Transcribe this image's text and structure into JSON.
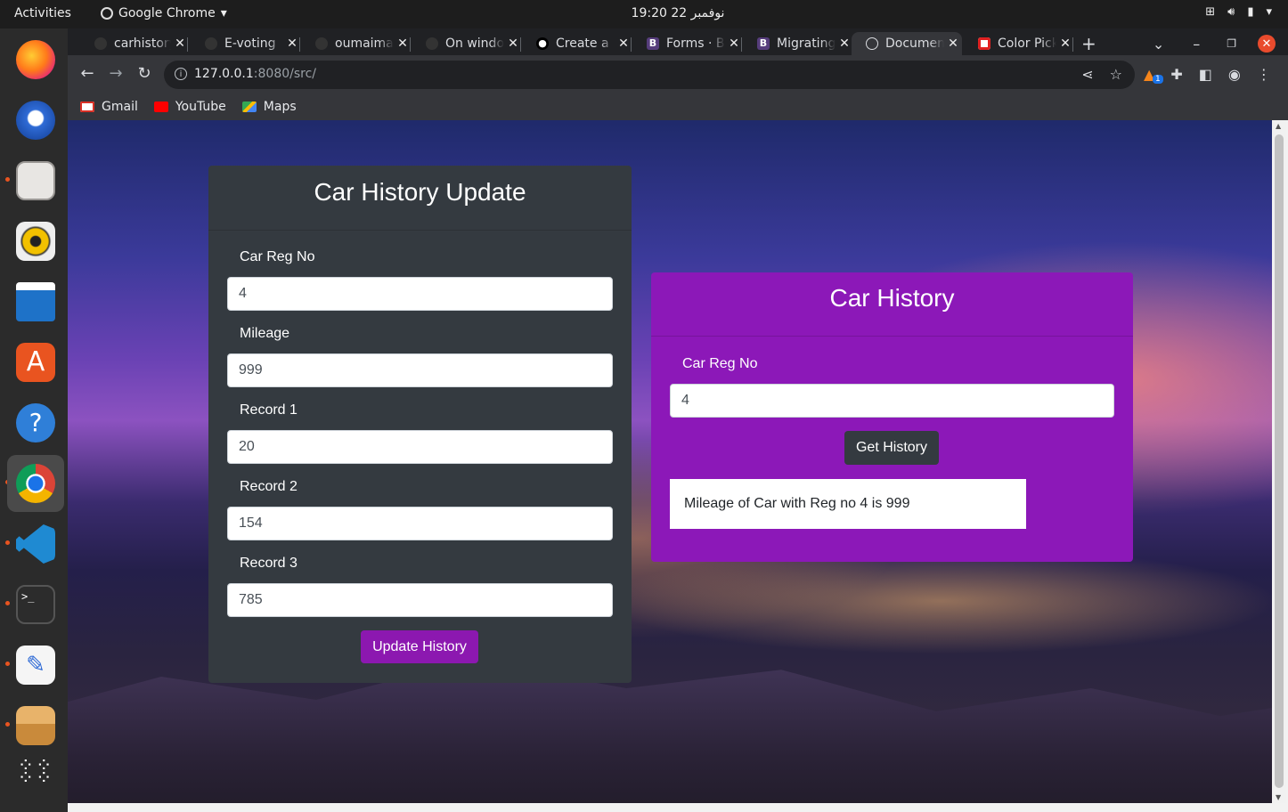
{
  "topbar": {
    "activities": "Activities",
    "app_name": "Google Chrome",
    "clock": "19:20  22 نوفمبر"
  },
  "chrome": {
    "tabs": [
      {
        "title": "carhistory",
        "active": false
      },
      {
        "title": "E-voting",
        "active": false
      },
      {
        "title": "oumaima",
        "active": false
      },
      {
        "title": "On windows",
        "active": false
      },
      {
        "title": "Create a",
        "active": false
      },
      {
        "title": "Forms · Bootstrap",
        "active": false
      },
      {
        "title": "Migrating",
        "active": false
      },
      {
        "title": "Document",
        "active": true
      },
      {
        "title": "Color Picker",
        "active": false
      }
    ],
    "new_tab": "+",
    "url_host": "127.0.0.1",
    "url_path": ":8080/src/",
    "bookmarks": [
      {
        "label": "Gmail"
      },
      {
        "label": "YouTube"
      },
      {
        "label": "Maps"
      }
    ],
    "ext_badge": "1"
  },
  "update_card": {
    "title": "Car History Update",
    "fields": [
      {
        "label": "Car Reg No",
        "value": "4"
      },
      {
        "label": "Mileage",
        "value": "999"
      },
      {
        "label": "Record 1",
        "value": "20"
      },
      {
        "label": "Record 2",
        "value": "154"
      },
      {
        "label": "Record 3",
        "value": "785"
      }
    ],
    "button": "Update History"
  },
  "history_card": {
    "title": "Car History",
    "label": "Car Reg No",
    "value": "4",
    "button": "Get History",
    "result": "Mileage of Car with Reg no 4 is 999"
  },
  "colors": {
    "accent_purple": "#8c18b8",
    "dark_card": "#343a40",
    "dock_dot": "#e95420"
  }
}
